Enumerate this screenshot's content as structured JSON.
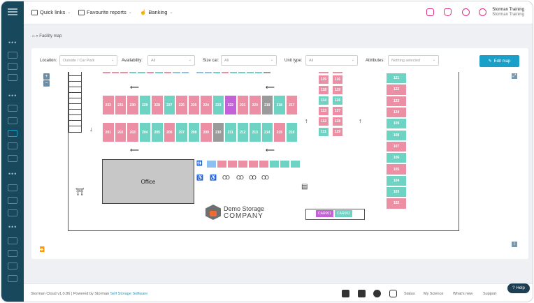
{
  "topbar": {
    "quick_links": "Quick links",
    "favourite_reports": "Favourite reports",
    "banking": "Banking",
    "user_name": "Storman Training",
    "user_role": "Storman Training"
  },
  "breadcrumb": "» Facility map",
  "filters": {
    "location_label": "Location:",
    "location_value": "Outside / Car Park",
    "availability_label": "Availability:",
    "availability_value": "All",
    "size_label": "Size cat:",
    "size_value": "All",
    "unit_type_label": "Unit type:",
    "unit_type_value": "All",
    "attributes_label": "Attributes:",
    "attributes_value": "Nothing selected"
  },
  "edit_map": "Edit map",
  "office_label": "Office",
  "logo": {
    "line1": "Demo Storage",
    "line2": "COMPANY"
  },
  "units_row1": [
    "232",
    "231",
    "230",
    "229",
    "228",
    "227",
    "226",
    "225",
    "224",
    "223",
    "222",
    "221",
    "220",
    "219",
    "218",
    "217"
  ],
  "units_row1_colors": [
    "pink",
    "pink",
    "pink",
    "teal",
    "pink",
    "teal",
    "pink",
    "pink",
    "pink",
    "teal",
    "purple",
    "pink",
    "pink",
    "grey",
    "teal",
    "pink"
  ],
  "units_row2": [
    "201",
    "202",
    "203",
    "204",
    "205",
    "206",
    "207",
    "208",
    "209",
    "210",
    "211",
    "212",
    "213",
    "214",
    "215",
    "216"
  ],
  "units_row2_colors": [
    "pink",
    "pink",
    "pink",
    "teal",
    "teal",
    "pink",
    "teal",
    "teal",
    "pink",
    "grey",
    "teal",
    "teal",
    "teal",
    "teal",
    "pink",
    "teal"
  ],
  "units_col_a": [
    "110",
    "113",
    "114",
    "113",
    "111",
    "112"
  ],
  "units_small_left": [
    [
      "115",
      "116"
    ],
    [
      "118",
      "119"
    ],
    [
      "114",
      "126"
    ],
    [
      "113",
      "127"
    ],
    [
      "112",
      "128"
    ],
    [
      "111",
      "129"
    ]
  ],
  "units_small_left_colors": [
    [
      "pink",
      "pink"
    ],
    [
      "pink",
      "pink"
    ],
    [
      "teal",
      "teal"
    ],
    [
      "pink",
      "pink"
    ],
    [
      "pink",
      "pink"
    ],
    [
      "teal",
      "pink"
    ]
  ],
  "units_right_col": [
    "121",
    "122",
    "123",
    "124",
    "109",
    "108",
    "107",
    "106",
    "105",
    "104",
    "103",
    "102"
  ],
  "units_right_col_colors": [
    "teal",
    "pink",
    "pink",
    "pink",
    "teal",
    "teal",
    "pink",
    "teal",
    "pink",
    "teal",
    "teal",
    "pink"
  ],
  "car_units": [
    {
      "label": "CAR001",
      "color": "purple"
    },
    {
      "label": "CAR002",
      "color": "teal"
    }
  ],
  "footer": {
    "text": "Storman Cloud v1.0.86 | Powered by Storman ",
    "link": "Self Storage Software",
    "status": "Status",
    "science": "My Science",
    "whats_new": "What's new",
    "support": "Support"
  },
  "help": "Help"
}
